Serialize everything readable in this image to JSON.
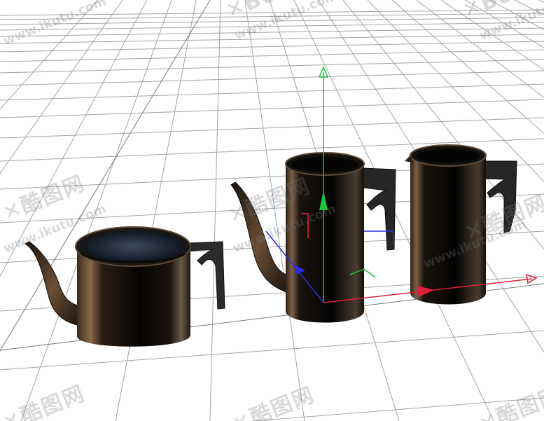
{
  "viewport": {
    "background": "#ffffff",
    "grid_color": "#9a9a9a",
    "axis_colors": {
      "x": "#e0203a",
      "y": "#1fc43a",
      "z": "#2a2ee0"
    }
  },
  "scene": {
    "objects": [
      {
        "name": "teapot-short",
        "type": "kettle with spout and handle"
      },
      {
        "name": "teapot-tall",
        "type": "tall kettle with spout and handle"
      },
      {
        "name": "pitcher",
        "type": "tall pitcher with handle"
      }
    ],
    "gizmo_icon": "transform-gizmo-icon"
  },
  "watermark": {
    "logo": "酷图网",
    "url": "www.ikutu.com",
    "top_logo": "Bo",
    "icon": "ikutu-logo-icon"
  }
}
